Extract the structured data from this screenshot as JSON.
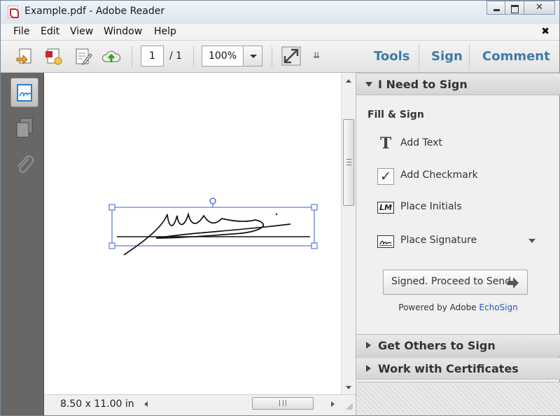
{
  "window": {
    "title": "Example.pdf - Adobe Reader",
    "icon": "pdf-file-icon",
    "controls": [
      "minimize-icon",
      "maximize-icon",
      "close-icon"
    ]
  },
  "menubar": {
    "items": [
      "File",
      "Edit",
      "View",
      "Window",
      "Help"
    ],
    "close_glyph": "✖"
  },
  "toolbar": {
    "icons": [
      "open-icon",
      "create-pdf-icon",
      "edit-icon",
      "upload-cloud-icon"
    ],
    "page_current": "1",
    "page_total": "/ 1",
    "zoom": "100%",
    "fit_icon": "fit-page-icon",
    "more_glyph": "⇊",
    "tabs": [
      "Tools",
      "Sign",
      "Comment"
    ]
  },
  "leftrail": {
    "icons": [
      "signature-panel-icon",
      "page-thumbnails-icon",
      "attachments-icon"
    ]
  },
  "status": {
    "page_size": "8.50 x 11.00 in"
  },
  "rightpane": {
    "section_sign": "I Need to Sign",
    "fill_sign_heading": "Fill & Sign",
    "actions": [
      {
        "label": "Add Text",
        "icon": "text-icon",
        "icon_text": "T"
      },
      {
        "label": "Add Checkmark",
        "icon": "checkmark-icon",
        "icon_text": "✓"
      },
      {
        "label": "Place Initials",
        "icon": "initials-icon",
        "icon_text": "LM"
      },
      {
        "label": "Place Signature",
        "icon": "signature-icon",
        "icon_text": ""
      }
    ],
    "proceed_button": "Signed. Proceed to Send",
    "powered_by": "Powered by Adobe",
    "powered_brand": "EchoSign",
    "section_others": "Get Others to Sign",
    "section_certs": "Work with Certificates"
  },
  "colors": {
    "accent_tab": "#3f7ca8",
    "selection_handle": "#3a5fcd",
    "brand_link": "#2a53b8",
    "left_rail": "#676767"
  }
}
